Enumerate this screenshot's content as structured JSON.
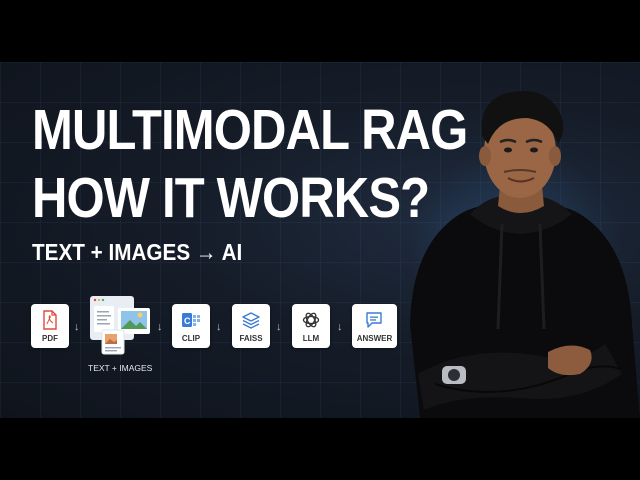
{
  "title": {
    "line1": "MULTIMODAL RAG",
    "line2": "HOW IT WORKS?"
  },
  "subtitle": "TEXT + IMAGES → AI",
  "pipeline": {
    "steps": [
      {
        "label": "PDF",
        "icon": "pdf-icon"
      },
      {
        "label": "TEXT + IMAGES",
        "icon": "documents-images-icon"
      },
      {
        "label": "CLIP",
        "icon": "clip-icon"
      },
      {
        "label": "FAISS",
        "icon": "layers-icon"
      },
      {
        "label": "LLM",
        "icon": "openai-icon"
      },
      {
        "label": "ANSWER",
        "icon": "chat-bubble-icon"
      }
    ],
    "arrow": "↓"
  },
  "colors": {
    "background": "#151c28",
    "text": "#ffffff",
    "pdf_red": "#e04a3b",
    "icon_blue": "#3a7bd5"
  }
}
